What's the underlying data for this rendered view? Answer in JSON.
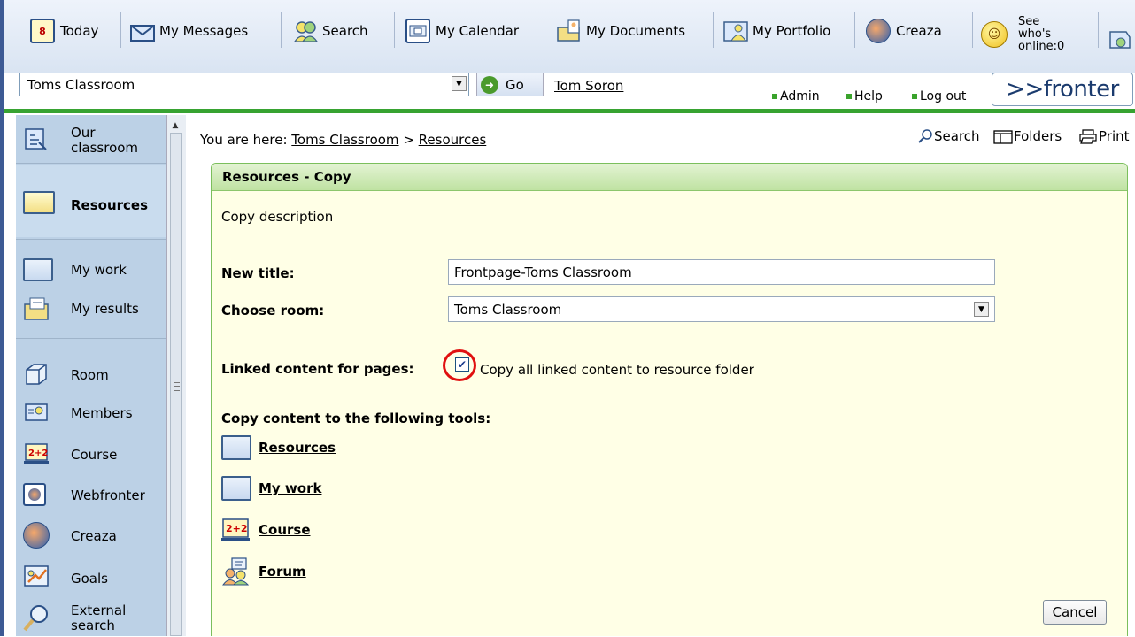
{
  "toolbar": {
    "items": [
      {
        "label": "Today",
        "icon": "calendar-day-icon"
      },
      {
        "label": "My Messages",
        "icon": "envelope-icon"
      },
      {
        "label": "Search",
        "icon": "people-search-icon"
      },
      {
        "label": "My Calendar",
        "icon": "calendar-icon"
      },
      {
        "label": "My Documents",
        "icon": "documents-icon"
      },
      {
        "label": "My Portfolio",
        "icon": "portfolio-icon"
      },
      {
        "label": "Creaza",
        "icon": "creaza-icon"
      }
    ],
    "online_line1": "See",
    "online_line2": "who's",
    "online_line3": "online:0"
  },
  "header": {
    "classroom": "Toms Classroom",
    "go_label": "Go",
    "user": "Tom Soron",
    "links": [
      "Admin",
      "Help",
      "Log out"
    ],
    "logo": ">>fronter"
  },
  "nav": {
    "items": [
      {
        "label": "Our classroom",
        "l1": "Our",
        "l2": "classroom",
        "icon": "classroom-icon"
      },
      {
        "label": "Resources",
        "icon": "folder-icon",
        "active": true
      },
      {
        "label": "My work",
        "icon": "folder-icon"
      },
      {
        "label": "My results",
        "icon": "results-icon"
      },
      {
        "label": "Room",
        "icon": "room-icon"
      },
      {
        "label": "Members",
        "icon": "members-icon"
      },
      {
        "label": "Course",
        "icon": "course-icon"
      },
      {
        "label": "Webfronter",
        "icon": "webfronter-icon"
      },
      {
        "label": "Creaza",
        "icon": "creaza-icon"
      },
      {
        "label": "Goals",
        "icon": "goals-icon"
      },
      {
        "label": "External search",
        "l1": "External",
        "l2": "search",
        "icon": "magnifier-icon"
      }
    ]
  },
  "breadcrumb": {
    "prefix": "You are here: ",
    "root": "Toms Classroom",
    "sep": " > ",
    "current": "Resources"
  },
  "tools": {
    "search": "Search",
    "folders": "Folders",
    "print": "Print"
  },
  "panel": {
    "title": "Resources - Copy",
    "description": "Copy description",
    "new_title_label": "New title:",
    "new_title_value": "Frontpage-Toms Classroom",
    "room_label": "Choose room:",
    "room_value": "Toms Classroom",
    "linked_label": "Linked content for pages:",
    "linked_checkbox_label": "Copy all linked content to resource folder",
    "linked_checked": true,
    "copy_tools_label": "Copy content to the following tools:",
    "copy_tools": [
      "Resources",
      "My work",
      "Course",
      "Forum"
    ],
    "cancel": "Cancel"
  },
  "colors": {
    "accent_green": "#37a331",
    "nav_bg": "#bcd1e6",
    "panel_bg": "#ffffe6",
    "highlight_ring": "#e01010"
  }
}
